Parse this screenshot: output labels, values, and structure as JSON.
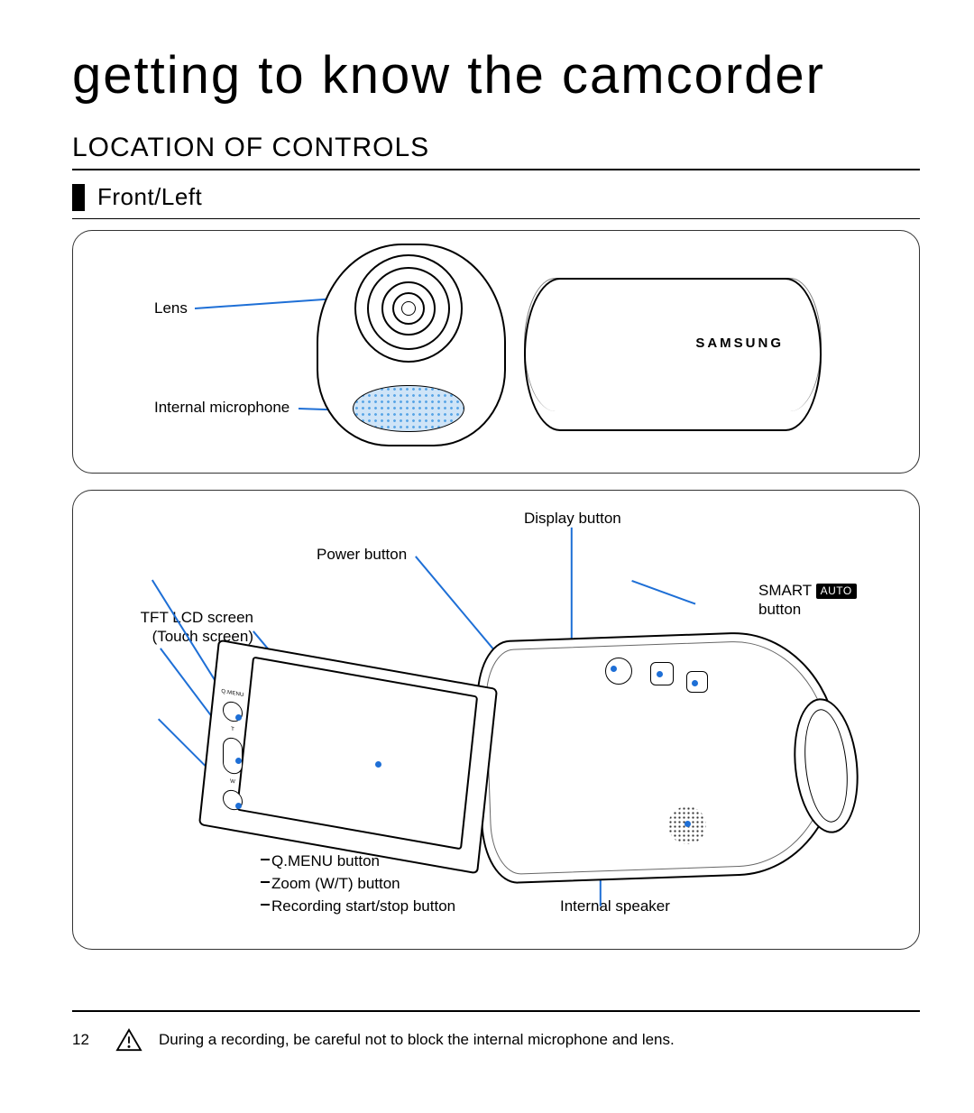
{
  "chapter_title": "getting to know the camcorder",
  "section_title": "LOCATION OF CONTROLS",
  "subsection": "Front/Left",
  "brand": "SAMSUNG",
  "front_labels": {
    "lens": "Lens",
    "mic": "Internal microphone"
  },
  "left_labels": {
    "power": "Power button",
    "display": "Display button",
    "smart_prefix": "SMART",
    "smart_badge": "AUTO",
    "smart_suffix": "button",
    "screen_l1": "TFT LCD screen",
    "screen_l2": "(Touch screen)",
    "qmenu": "Q.MENU button",
    "zoom": "Zoom (W/T) button",
    "rec": "Recording start/stop button",
    "speaker": "Internal speaker",
    "qmenu_tag": "Q.MENU"
  },
  "footnote": "During a recording, be careful not to block the internal microphone and lens.",
  "page_number": "12"
}
